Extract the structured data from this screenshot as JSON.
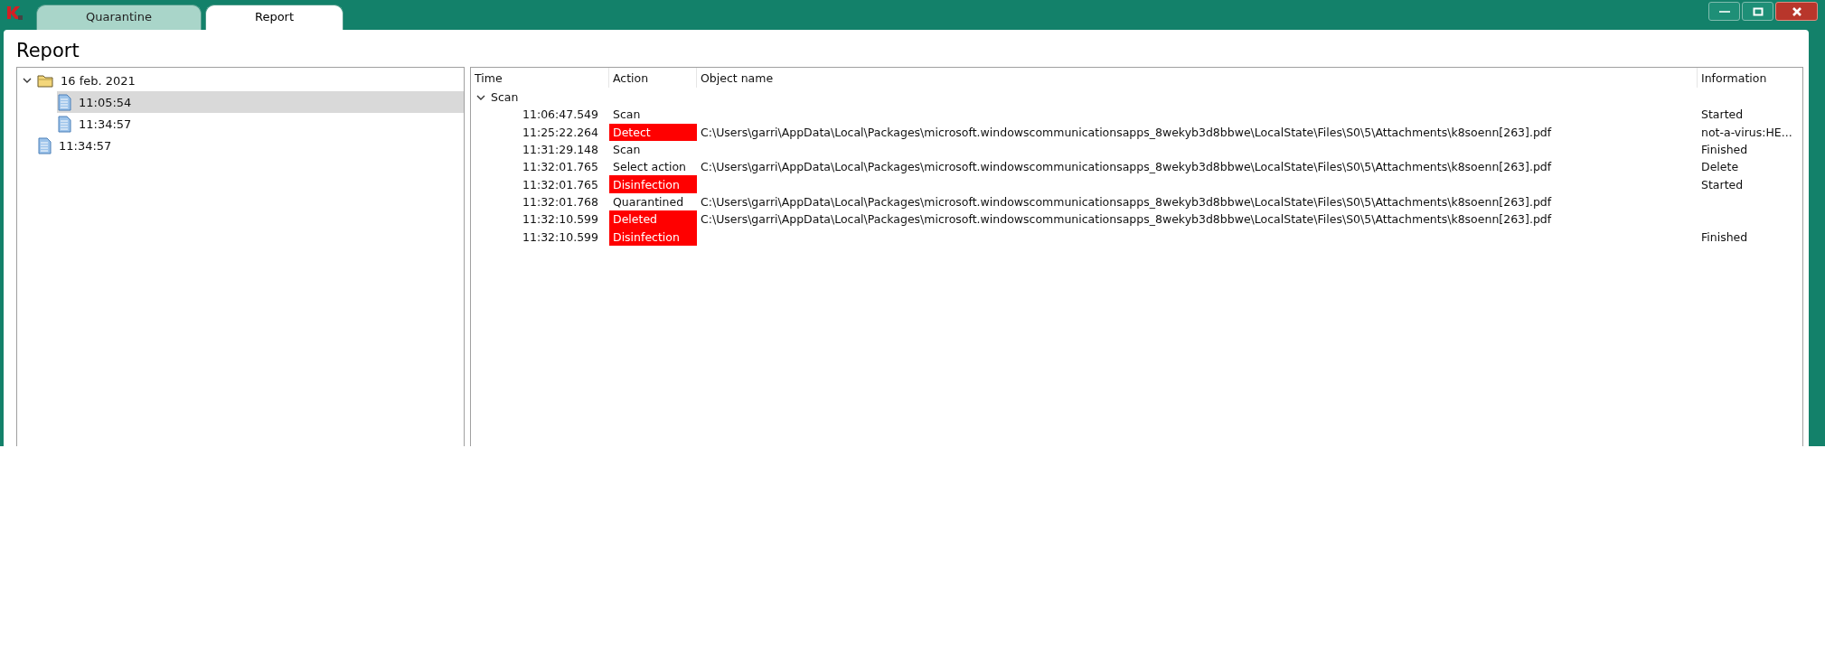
{
  "window": {
    "tabs": [
      {
        "label": "Quarantine",
        "selected": false
      },
      {
        "label": "Report",
        "selected": true
      }
    ],
    "title": "Report"
  },
  "tree": {
    "items": [
      {
        "label": "16 feb. 2021",
        "kind": "folder",
        "expanded": true,
        "selected": false,
        "children": [
          {
            "label": "11:05:54",
            "kind": "report",
            "selected": true
          },
          {
            "label": "11:34:57",
            "kind": "report",
            "selected": false
          }
        ]
      },
      {
        "label": "11:34:57",
        "kind": "report",
        "selected": false
      }
    ]
  },
  "table": {
    "columns": [
      "Time",
      "Action",
      "Object name",
      "Information"
    ],
    "groups": [
      {
        "label": "Scan",
        "expanded": true,
        "rows": [
          {
            "time": "11:06:47.549",
            "action": "Scan",
            "alert": false,
            "object": "",
            "information": "Started"
          },
          {
            "time": "11:25:22.264",
            "action": "Detect",
            "alert": true,
            "object": "C:\\Users\\garri\\AppData\\Local\\Packages\\microsoft.windowscommunicationsapps_8wekyb3d8bbwe\\LocalState\\Files\\S0\\5\\Attachments\\k8soenn[263].pdf",
            "information": "not-a-virus:HE..."
          },
          {
            "time": "11:31:29.148",
            "action": "Scan",
            "alert": false,
            "object": "",
            "information": "Finished"
          },
          {
            "time": "11:32:01.765",
            "action": "Select action",
            "alert": false,
            "object": "C:\\Users\\garri\\AppData\\Local\\Packages\\microsoft.windowscommunicationsapps_8wekyb3d8bbwe\\LocalState\\Files\\S0\\5\\Attachments\\k8soenn[263].pdf",
            "information": "Delete"
          },
          {
            "time": "11:32:01.765",
            "action": "Disinfection",
            "alert": true,
            "object": "",
            "information": "Started"
          },
          {
            "time": "11:32:01.768",
            "action": "Quarantined",
            "alert": false,
            "object": "C:\\Users\\garri\\AppData\\Local\\Packages\\microsoft.windowscommunicationsapps_8wekyb3d8bbwe\\LocalState\\Files\\S0\\5\\Attachments\\k8soenn[263].pdf",
            "information": ""
          },
          {
            "time": "11:32:10.599",
            "action": "Deleted",
            "alert": true,
            "object": "C:\\Users\\garri\\AppData\\Local\\Packages\\microsoft.windowscommunicationsapps_8wekyb3d8bbwe\\LocalState\\Files\\S0\\5\\Attachments\\k8soenn[263].pdf",
            "information": ""
          },
          {
            "time": "11:32:10.599",
            "action": "Disinfection",
            "alert": true,
            "object": "",
            "information": "Finished"
          }
        ]
      }
    ]
  }
}
